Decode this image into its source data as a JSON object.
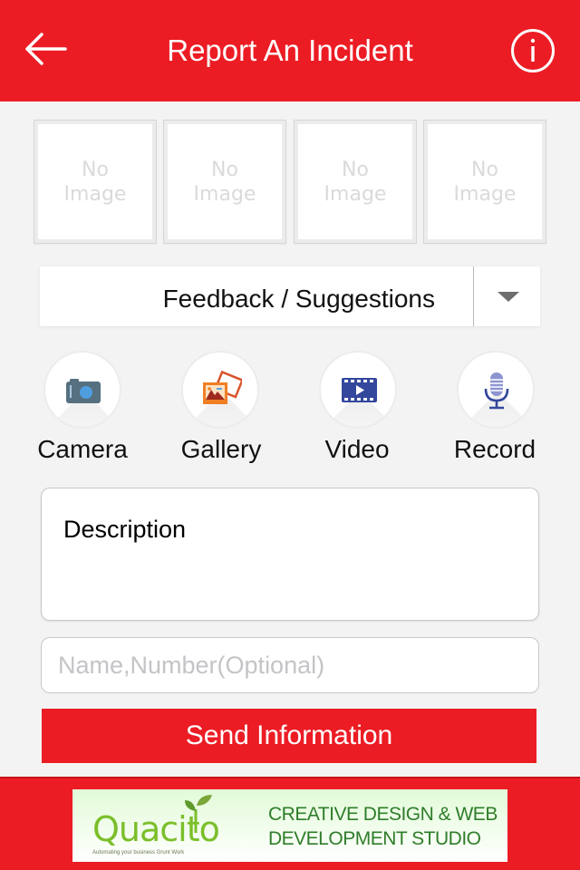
{
  "header": {
    "title": "Report An Incident",
    "back_icon": "arrow-left-icon",
    "info_icon": "info-circle-icon",
    "color": "#ec1c24"
  },
  "image_slots": [
    {
      "label": "No\nImage"
    },
    {
      "label": "No\nImage"
    },
    {
      "label": "No\nImage"
    },
    {
      "label": "No\nImage"
    }
  ],
  "category_dropdown": {
    "selected": "Feedback / Suggestions",
    "icon": "caret-down-icon"
  },
  "media_buttons": [
    {
      "label": "Camera",
      "icon": "camera-icon"
    },
    {
      "label": "Gallery",
      "icon": "gallery-icon"
    },
    {
      "label": "Video",
      "icon": "video-icon"
    },
    {
      "label": "Record",
      "icon": "microphone-icon"
    }
  ],
  "form": {
    "description_placeholder": "Description",
    "name_placeholder": "Name,Number(Optional)",
    "name_value": "",
    "send_label": "Send Information"
  },
  "footer_ad": {
    "brand": "Quacito",
    "tagline": "Automating your business Grunt Work",
    "text": "CREATIVE DESIGN & WEB\nDEVELOPMENT STUDIO"
  }
}
